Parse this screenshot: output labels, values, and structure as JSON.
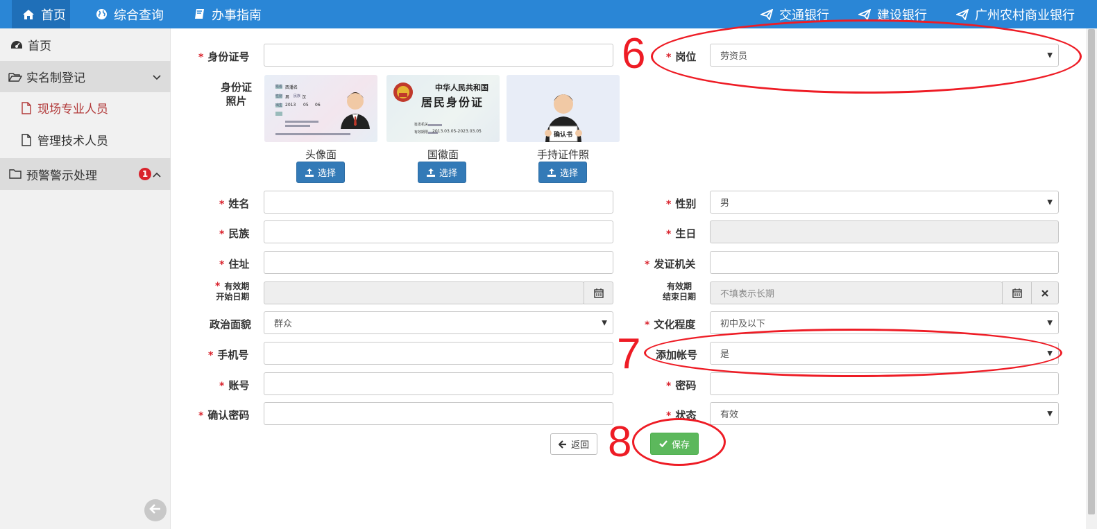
{
  "topnav": {
    "home": "首页",
    "query": "综合查询",
    "guide": "办事指南",
    "bank1": "交通银行",
    "bank2": "建设银行",
    "bank3": "广州农村商业银行"
  },
  "sidebar": {
    "home": "首页",
    "group1": "实名制登记",
    "sub1": "现场专业人员",
    "sub2": "管理技术人员",
    "group2": "预警警示处理",
    "badge": "1"
  },
  "form": {
    "idcard_label": "身份证号",
    "idcard_value": "",
    "photo_label_line1": "身份证",
    "photo_label_line2": "照片",
    "photo_front": "头像面",
    "photo_back": "国徽面",
    "photo_hold": "手持证件照",
    "select_btn": "选择",
    "post_label": "岗位",
    "post_value": "劳资员",
    "name_label": "姓名",
    "gender_label": "性别",
    "gender_value": "男",
    "ethnic_label": "民族",
    "birth_label": "生日",
    "address_label": "住址",
    "issuer_label": "发证机关",
    "valid_start_l1": "有效期",
    "valid_start_l2": "开始日期",
    "valid_end_l1": "有效期",
    "valid_end_l2": "结束日期",
    "valid_end_placeholder": "不填表示长期",
    "political_label": "政治面貌",
    "political_value": "群众",
    "education_label": "文化程度",
    "education_value": "初中及以下",
    "phone_label": "手机号",
    "add_account_label": "添加帐号",
    "add_account_value": "是",
    "account_label": "账号",
    "password_label": "密码",
    "confirm_label": "确认密码",
    "status_label": "状态",
    "status_value": "有效",
    "back_btn": "返回",
    "save_btn": "保存"
  },
  "card_front": {
    "name_tag": "姓名",
    "name_val": "西潘名",
    "sex_tag": "性别",
    "sex_val": "男",
    "nation_tag": "民族",
    "nation_val": "汉",
    "birth_tag": "出生",
    "birth_y": "2013",
    "birth_m": "05",
    "birth_d": "06"
  },
  "card_back": {
    "title1": "中华人民共和国",
    "title2": "居民身份证",
    "issuer_tag": "签发机关",
    "valid_tag": "有效期限",
    "valid_val": "2013.03.05-2023.03.05"
  },
  "card_hold": {
    "sign": "确认书"
  },
  "annotations": {
    "n6": "6",
    "n7": "7",
    "n8": "8",
    "color": "#ee1c25"
  },
  "colors": {
    "topbar": "#2a86d6",
    "primary_btn": "#337ab7",
    "save_btn": "#5cb85c",
    "required": "#d9232d"
  }
}
